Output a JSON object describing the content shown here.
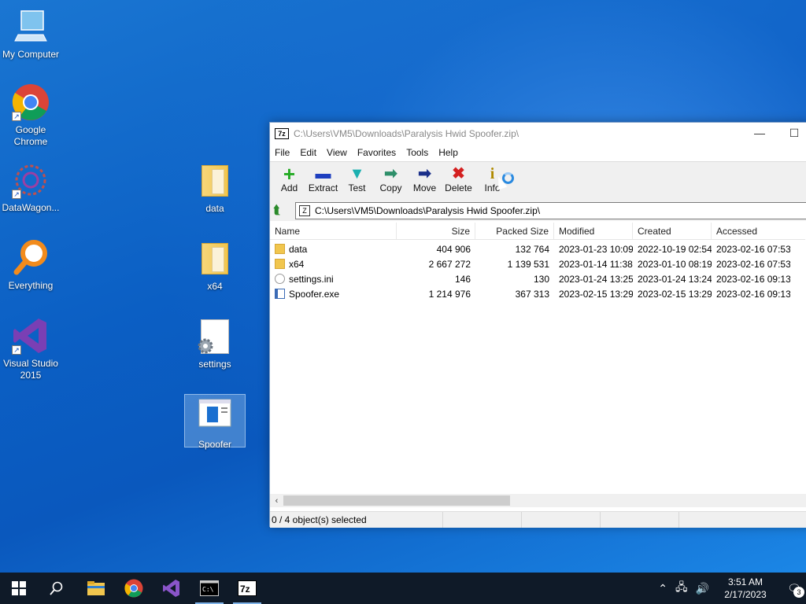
{
  "desktop": {
    "icons": [
      {
        "label": "My Computer"
      },
      {
        "label": "Google Chrome"
      },
      {
        "label": "DataWagon..."
      },
      {
        "label": "Everything"
      },
      {
        "label": "Visual Studio 2015"
      },
      {
        "label": "data"
      },
      {
        "label": "x64"
      },
      {
        "label": "settings"
      },
      {
        "label": "Spoofer"
      }
    ]
  },
  "window": {
    "logo": "7z",
    "title": "C:\\Users\\VM5\\Downloads\\Paralysis Hwid Spoofer.zip\\",
    "controls": {
      "minimize": "—",
      "maximize": "☐"
    },
    "menu": [
      "File",
      "Edit",
      "View",
      "Favorites",
      "Tools",
      "Help"
    ],
    "toolbar": [
      {
        "label": "Add",
        "icon": "+",
        "color": "#22aa22"
      },
      {
        "label": "Extract",
        "icon": "▬",
        "color": "#1e3fbf"
      },
      {
        "label": "Test",
        "icon": "▼",
        "color": "#1cb0b0"
      },
      {
        "label": "Copy",
        "icon": "➡",
        "color": "#2e8f6a"
      },
      {
        "label": "Move",
        "icon": "➡",
        "color": "#1a2f8a"
      },
      {
        "label": "Delete",
        "icon": "✖",
        "color": "#d42020"
      },
      {
        "label": "Info",
        "icon": "i",
        "color": "#b08a00"
      }
    ],
    "address": {
      "zip_icon": "Z",
      "path": "C:\\Users\\VM5\\Downloads\\Paralysis Hwid Spoofer.zip\\"
    },
    "columns": [
      "Name",
      "Size",
      "Packed Size",
      "Modified",
      "Created",
      "Accessed"
    ],
    "rows": [
      {
        "type": "folder",
        "name": "data",
        "size": "404 906",
        "packed": "132 764",
        "modified": "2023-01-23 10:09",
        "created": "2022-10-19 02:54",
        "accessed": "2023-02-16 07:53"
      },
      {
        "type": "folder",
        "name": "x64",
        "size": "2 667 272",
        "packed": "1 139 531",
        "modified": "2023-01-14 11:38",
        "created": "2023-01-10 08:19",
        "accessed": "2023-02-16 07:53"
      },
      {
        "type": "ini",
        "name": "settings.ini",
        "size": "146",
        "packed": "130",
        "modified": "2023-01-24 13:25",
        "created": "2023-01-24 13:24",
        "accessed": "2023-02-16 09:13"
      },
      {
        "type": "exe",
        "name": "Spoofer.exe",
        "size": "1 214 976",
        "packed": "367 313",
        "modified": "2023-02-15 13:29",
        "created": "2023-02-15 13:29",
        "accessed": "2023-02-16 09:13"
      }
    ],
    "status": {
      "selected": "0 / 4 object(s) selected",
      "cell2": "",
      "cell3": "",
      "cell4": ""
    }
  },
  "taskbar": {
    "clock_time": "3:51 AM",
    "clock_date": "2/17/2023",
    "notifications": "3"
  }
}
